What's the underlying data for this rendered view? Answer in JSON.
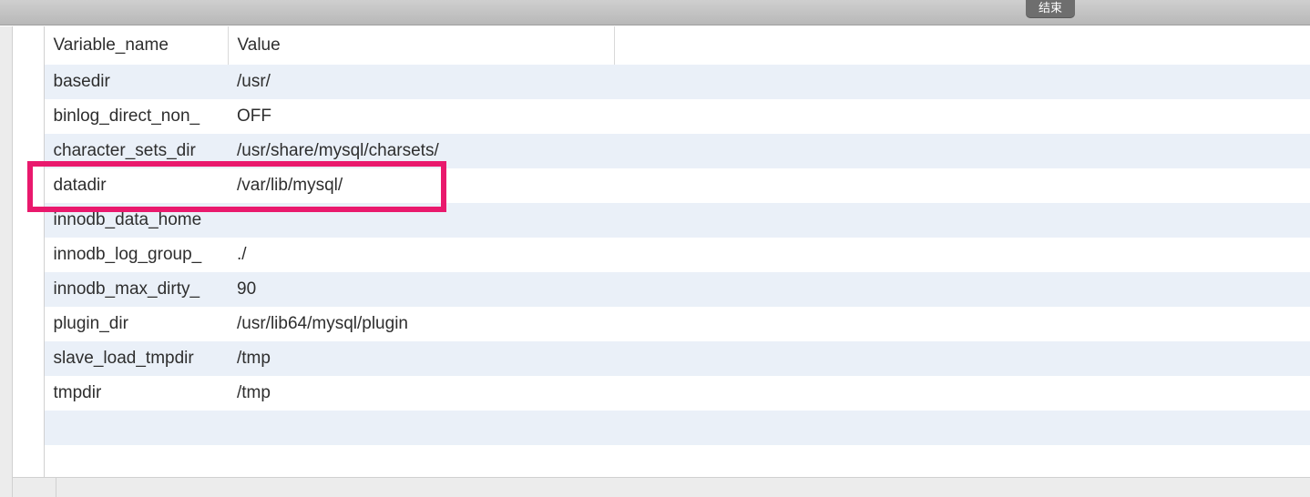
{
  "toolbar": {
    "button_label": "结束"
  },
  "columns": {
    "c1": "Variable_name",
    "c2": "Value"
  },
  "rows": [
    {
      "name": "basedir",
      "value": "/usr/"
    },
    {
      "name": "binlog_direct_non_",
      "value": "OFF"
    },
    {
      "name": "character_sets_dir",
      "value": "/usr/share/mysql/charsets/"
    },
    {
      "name": "datadir",
      "value": "/var/lib/mysql/"
    },
    {
      "name": "innodb_data_home",
      "value": ""
    },
    {
      "name": "innodb_log_group_",
      "value": "./"
    },
    {
      "name": "innodb_max_dirty_",
      "value": "90"
    },
    {
      "name": "plugin_dir",
      "value": "/usr/lib64/mysql/plugin"
    },
    {
      "name": "slave_load_tmpdir",
      "value": "/tmp"
    },
    {
      "name": "tmpdir",
      "value": "/tmp"
    }
  ],
  "highlight_row_index": 3,
  "empty_trailing_rows": 2,
  "highlight_color": "#e9196d"
}
